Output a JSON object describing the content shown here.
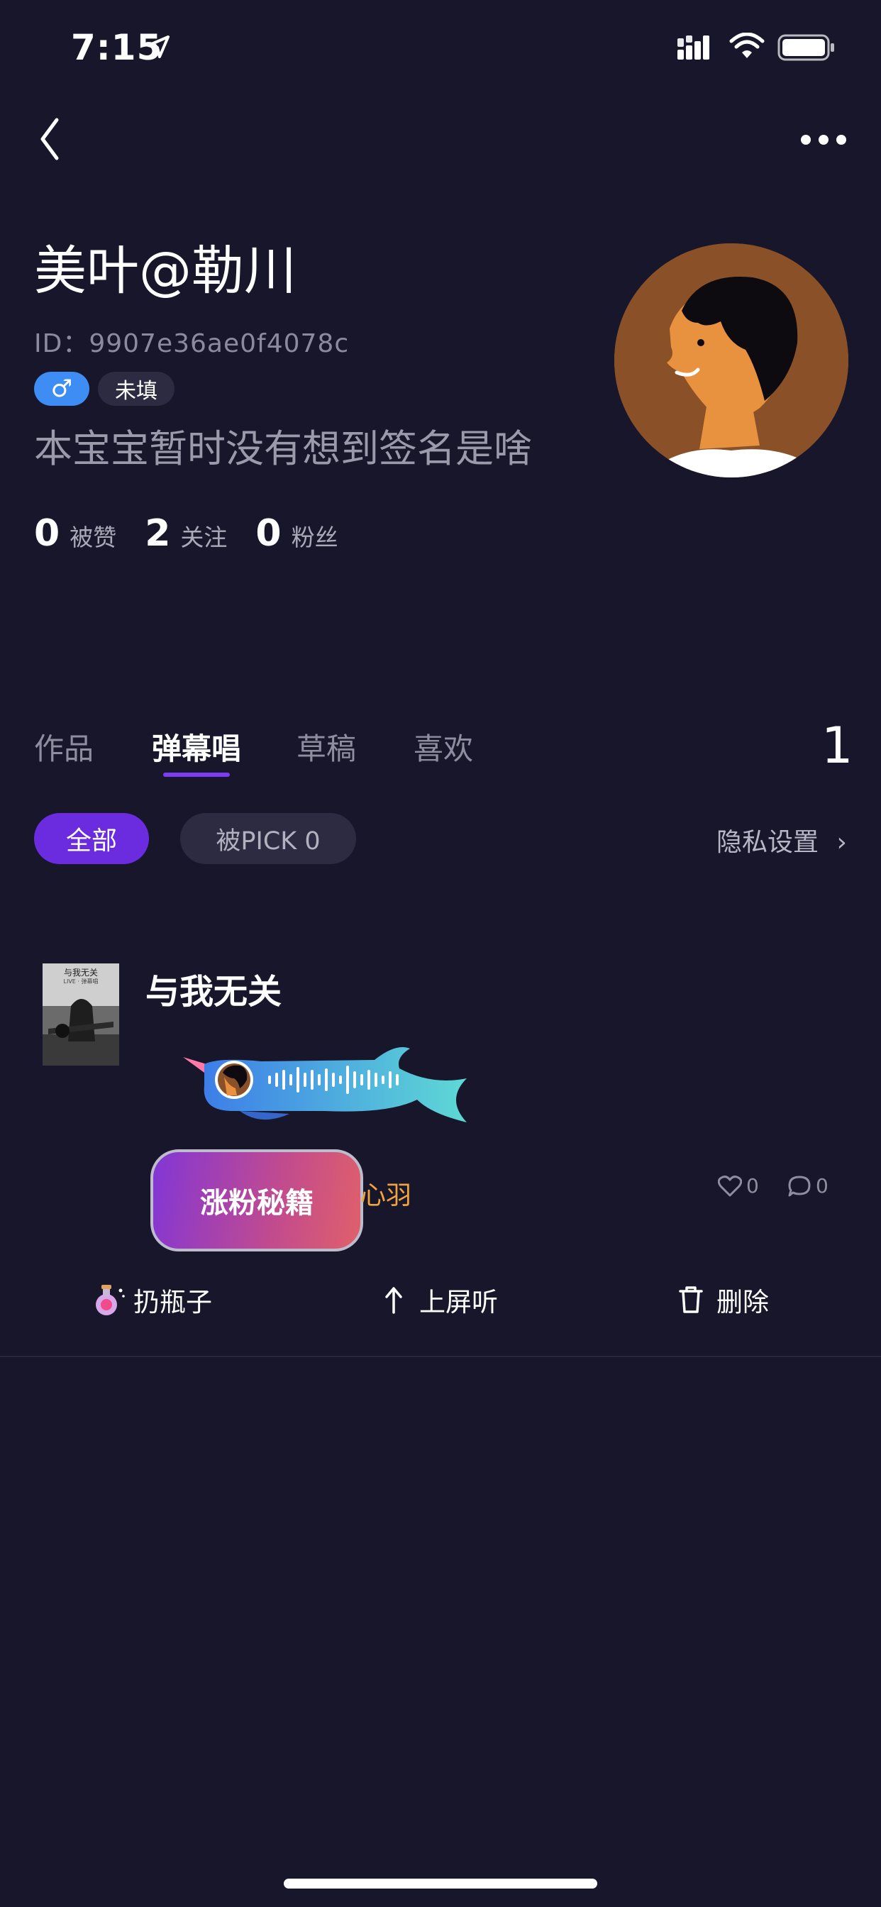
{
  "status": {
    "time": "7:15"
  },
  "profile": {
    "name": "美叶@勒川",
    "id_text": "ID：9907e36ae0f4078c",
    "gender_symbol": "♂",
    "unset_tag": "未填",
    "signature": "本宝宝暂时没有想到签名是啥",
    "stats": [
      {
        "num": "0",
        "label": "被赞"
      },
      {
        "num": "2",
        "label": "关注"
      },
      {
        "num": "0",
        "label": "粉丝"
      }
    ]
  },
  "tabs": [
    {
      "label": "作品"
    },
    {
      "label": "弹幕唱",
      "active": true
    },
    {
      "label": "草稿"
    },
    {
      "label": "喜欢"
    }
  ],
  "tab_count": "1",
  "filters": {
    "all": "全部",
    "pick": "被PICK 0",
    "privacy": "隐私设置",
    "privacy_chevron": "›"
  },
  "item": {
    "cover_title": "与我无关",
    "cover_subtitle": "LIVE · 弹幕唱",
    "title": "与我无关",
    "promo_label": "涨粉秘籍",
    "author": "心羽",
    "likes": "0",
    "comments": "0"
  },
  "actions": {
    "bottle": "扔瓶子",
    "onscreen": "上屏听",
    "delete": "删除"
  },
  "colors": {
    "background": "#17162b",
    "accent": "#6b2ce0",
    "gender": "#3d8df5",
    "author": "#f0a43a"
  },
  "icons": [
    "back-icon",
    "more-icon",
    "location-arrow-icon",
    "signal-icon",
    "wifi-icon",
    "battery-icon",
    "heart-icon",
    "comment-icon",
    "bottle-icon",
    "upload-arrow-icon",
    "trash-icon"
  ]
}
